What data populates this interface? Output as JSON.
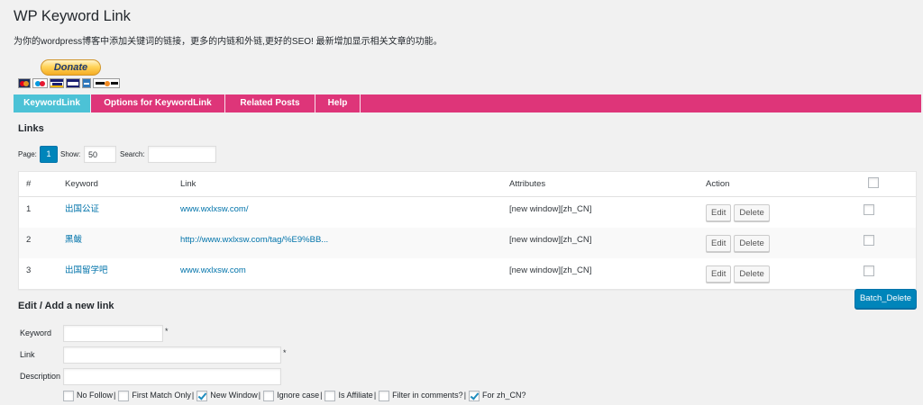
{
  "colors": {
    "page_bg": "#f1f1f1",
    "tab_bar": "#de3579",
    "tab_active": "#4cc2d6",
    "link": "#0073aa",
    "primary_button": "#0085ba"
  },
  "header": {
    "title": "WP Keyword Link",
    "subtitle": "为你的wordpress博客中添加关键词的链接，更多的内链和外链,更好的SEO! 最新增加显示相关文章的功能。"
  },
  "donate": {
    "label": "Donate",
    "card_icons": [
      "mastercard-icon",
      "maestro-icon",
      "visa-icon",
      "visa-electron-icon",
      "amex-icon",
      "discover-icon"
    ]
  },
  "tabs": [
    {
      "label": "KeywordLink",
      "active": true
    },
    {
      "label": "Options for KeywordLink",
      "active": false
    },
    {
      "label": "Related Posts",
      "active": false
    },
    {
      "label": "Help",
      "active": false
    }
  ],
  "links_section": {
    "heading": "Links",
    "pager": {
      "page_label": "Page:",
      "current_page": "1",
      "show_label": "Show:",
      "show_value": "50",
      "search_label": "Search:",
      "search_value": ""
    },
    "table": {
      "columns": [
        "#",
        "Keyword",
        "Link",
        "Attributes",
        "Action"
      ],
      "select_all_checked": false,
      "rows": [
        {
          "num": "1",
          "keyword": "出国公证",
          "link": "www.wxlxsw.com/",
          "attributes": "[new window][zh_CN]",
          "selected": false
        },
        {
          "num": "2",
          "keyword": "黑鲅",
          "link": "http://www.wxlxsw.com/tag/%E9%BB...",
          "attributes": "[new window][zh_CN]",
          "selected": false
        },
        {
          "num": "3",
          "keyword": "出国留学吧",
          "link": "www.wxlxsw.com",
          "attributes": "[new window][zh_CN]",
          "selected": false
        }
      ],
      "edit_label": "Edit",
      "delete_label": "Delete"
    },
    "batch_delete_label": "Batch_Delete"
  },
  "form": {
    "heading": "Edit / Add a new link",
    "fields": [
      {
        "label": "Keyword",
        "value": "",
        "required_mark": "*"
      },
      {
        "label": "Link",
        "value": "",
        "required_mark": "*"
      },
      {
        "label": "Description",
        "value": ""
      }
    ],
    "separator": "|",
    "options": [
      {
        "label": "No Follow",
        "checked": false
      },
      {
        "label": "First Match Only",
        "checked": false
      },
      {
        "label": "New Window",
        "checked": true
      },
      {
        "label": "Ignore case",
        "checked": false
      },
      {
        "label": "Is Affiliate",
        "checked": false
      },
      {
        "label": "Filter in comments?",
        "checked": false
      },
      {
        "label": "For zh_CN?",
        "checked": true
      }
    ]
  }
}
